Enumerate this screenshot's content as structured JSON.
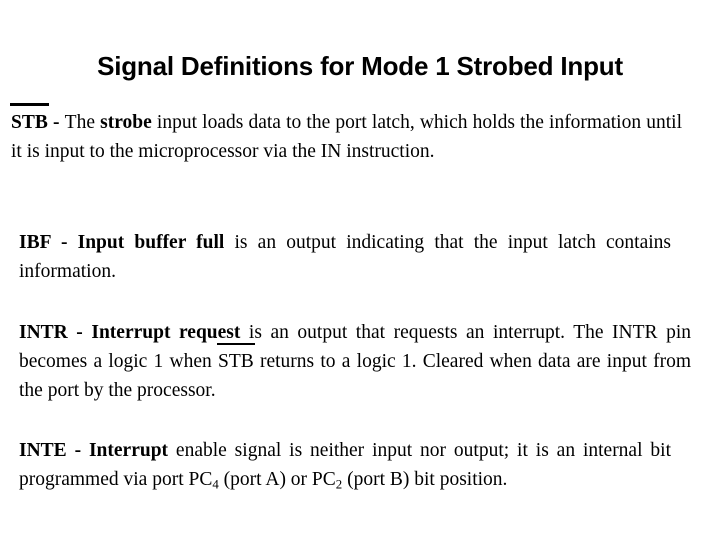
{
  "slide": {
    "title": "Signal Definitions for Mode 1 Strobed Input",
    "background_color": "#ffffff",
    "text_color": "#000000"
  },
  "paragraphs": [
    {
      "id": "stb",
      "signal_name": "STB",
      "signal_overlined": true,
      "separator": " - ",
      "lead_in": "The ",
      "term": "strobe",
      "body": " input loads data to the port latch, which holds the information until it is input to the microprocessor via the IN instruction."
    },
    {
      "id": "ibf",
      "signal_name": "IBF",
      "signal_overlined": false,
      "separator": " - ",
      "term": "Input buffer full",
      "body": " is an output indicating that the input latch contains information."
    },
    {
      "id": "intr",
      "signal_name": "INTR",
      "signal_overlined": false,
      "separator": " - ",
      "term": "Interrupt request",
      "body_part1": " is an output that requests an interrupt. The INTR pin becomes a logic 1 when ",
      "inline_overlined_signal": "STB",
      "body_part2": " returns to a logic 1. Cleared when data are input from the port by the processor."
    },
    {
      "id": "inte",
      "signal_name": "INTE",
      "signal_overlined": false,
      "separator": " - ",
      "term": "Interrupt",
      "body_part1": " enable signal is neither input nor output; it is an internal bit programmed via port PC",
      "subscript1": "4",
      "body_part2": " (port A) or PC",
      "subscript2": "2",
      "body_part3": " (port B) bit position."
    }
  ]
}
